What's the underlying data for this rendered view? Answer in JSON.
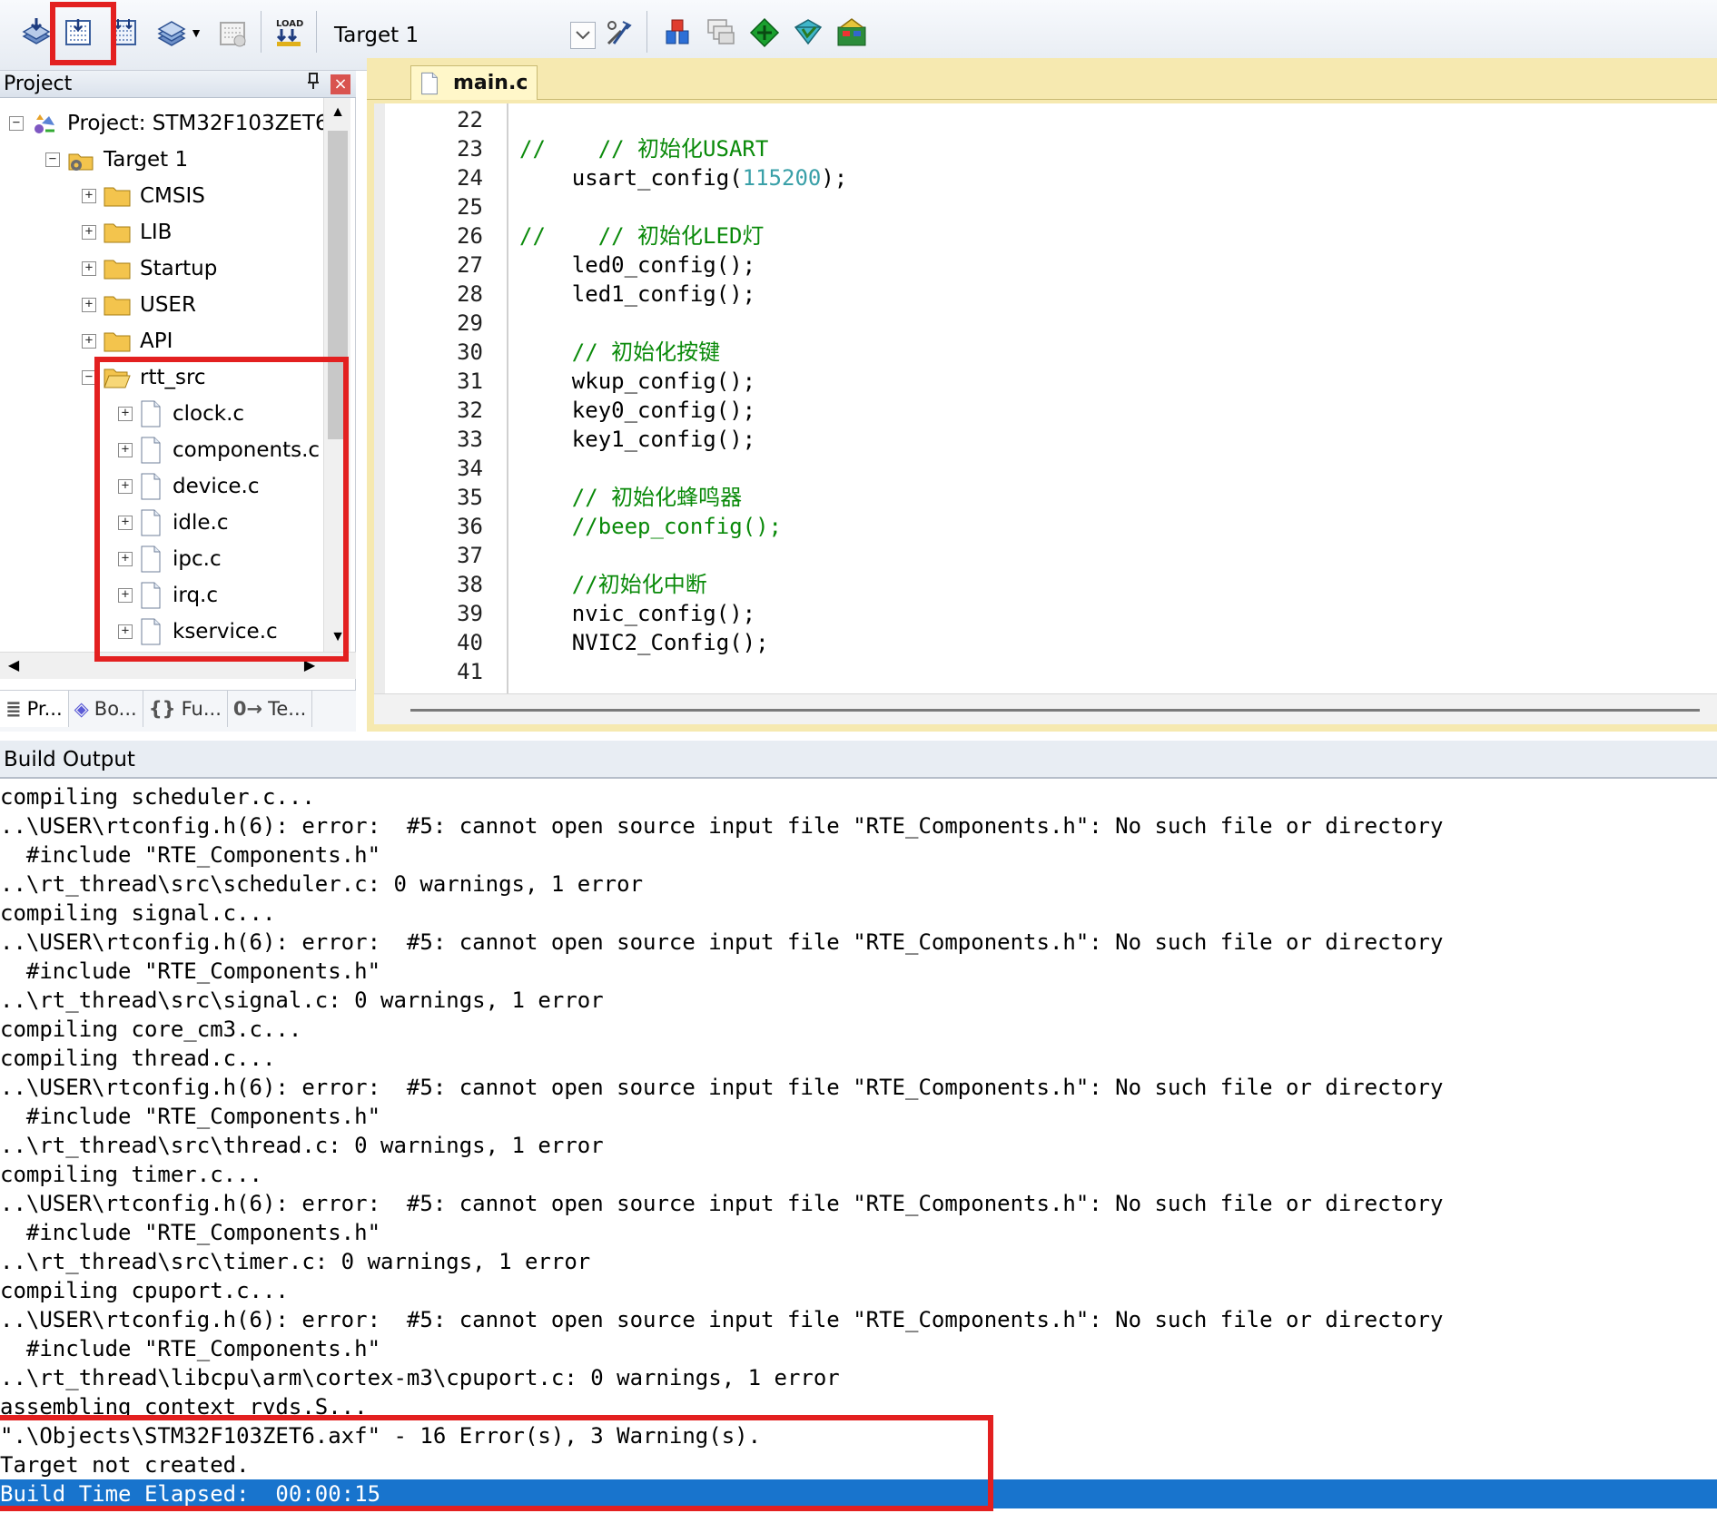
{
  "toolbar": {
    "buttons": [
      {
        "name": "translate-icon"
      },
      {
        "name": "build-icon"
      },
      {
        "name": "rebuild-icon"
      },
      {
        "name": "batch-build-icon"
      },
      {
        "name": "stop-build-icon"
      },
      {
        "name": "download-icon"
      }
    ],
    "target_select": "Target 1",
    "right_buttons": [
      {
        "name": "target-options-icon"
      },
      {
        "name": "manage-project-items-icon"
      },
      {
        "name": "select-packs-icon"
      },
      {
        "name": "manage-rte-icon"
      },
      {
        "name": "pack-installer-icon"
      },
      {
        "name": "view-rte-icon"
      }
    ],
    "highlight_color": "#e32020"
  },
  "project_pane": {
    "title": "Project",
    "pin": "ᵖ",
    "close": "×",
    "tree": [
      {
        "label": "Project: STM32F103ZET6",
        "sign": "⊟",
        "kind": "project"
      },
      {
        "label": "Target 1",
        "sign": "⊟",
        "kind": "target"
      },
      {
        "label": "CMSIS",
        "sign": "+",
        "kind": "folder"
      },
      {
        "label": "LIB",
        "sign": "+",
        "kind": "folder"
      },
      {
        "label": "Startup",
        "sign": "+",
        "kind": "folder"
      },
      {
        "label": "USER",
        "sign": "+",
        "kind": "folder"
      },
      {
        "label": "API",
        "sign": "+",
        "kind": "folder"
      },
      {
        "label": "rtt_src",
        "sign": "−",
        "kind": "folder-open"
      },
      {
        "label": "clock.c",
        "sign": "+",
        "kind": "file"
      },
      {
        "label": "components.c",
        "sign": "+",
        "kind": "file"
      },
      {
        "label": "device.c",
        "sign": "+",
        "kind": "file"
      },
      {
        "label": "idle.c",
        "sign": "+",
        "kind": "file"
      },
      {
        "label": "ipc.c",
        "sign": "+",
        "kind": "file"
      },
      {
        "label": "irq.c",
        "sign": "+",
        "kind": "file"
      },
      {
        "label": "kservice.c",
        "sign": "+",
        "kind": "file"
      }
    ],
    "tabs": [
      {
        "icon": "≣",
        "label": "Pr..."
      },
      {
        "icon": "◈",
        "label": "Bo..."
      },
      {
        "icon": "{}",
        "label": "Fu..."
      },
      {
        "icon": "0→",
        "label": "Te..."
      }
    ]
  },
  "editor": {
    "tab_label": "main.c",
    "lines": [
      {
        "n": "22",
        "segs": []
      },
      {
        "n": "23",
        "segs": [
          {
            "t": "//    // 初始化USART",
            "c": "cmt"
          }
        ]
      },
      {
        "n": "24",
        "segs": [
          {
            "t": "    usart_config(",
            "c": ""
          },
          {
            "t": "115200",
            "c": "num"
          },
          {
            "t": ");",
            "c": ""
          }
        ]
      },
      {
        "n": "25",
        "segs": []
      },
      {
        "n": "26",
        "segs": [
          {
            "t": "//    // 初始化LED灯",
            "c": "cmt"
          }
        ]
      },
      {
        "n": "27",
        "segs": [
          {
            "t": "    led0_config();",
            "c": ""
          }
        ]
      },
      {
        "n": "28",
        "segs": [
          {
            "t": "    led1_config();",
            "c": ""
          }
        ]
      },
      {
        "n": "29",
        "segs": []
      },
      {
        "n": "30",
        "segs": [
          {
            "t": "    // 初始化按键",
            "c": "cmt"
          }
        ]
      },
      {
        "n": "31",
        "segs": [
          {
            "t": "    wkup_config();",
            "c": ""
          }
        ]
      },
      {
        "n": "32",
        "segs": [
          {
            "t": "    key0_config();",
            "c": ""
          }
        ]
      },
      {
        "n": "33",
        "segs": [
          {
            "t": "    key1_config();",
            "c": ""
          }
        ]
      },
      {
        "n": "34",
        "segs": []
      },
      {
        "n": "35",
        "segs": [
          {
            "t": "    // 初始化蜂鸣器",
            "c": "cmt"
          }
        ]
      },
      {
        "n": "36",
        "segs": [
          {
            "t": "    //beep_config();",
            "c": "cmt"
          }
        ]
      },
      {
        "n": "37",
        "segs": []
      },
      {
        "n": "38",
        "segs": [
          {
            "t": "    //初始化中断",
            "c": "cmt"
          }
        ]
      },
      {
        "n": "39",
        "segs": [
          {
            "t": "    nvic_config();",
            "c": ""
          }
        ]
      },
      {
        "n": "40",
        "segs": [
          {
            "t": "    NVIC2_Config();",
            "c": ""
          }
        ]
      },
      {
        "n": "41",
        "segs": []
      }
    ]
  },
  "build_output": {
    "title": "Build Output",
    "lines": [
      "compiling scheduler.c...",
      "..\\USER\\rtconfig.h(6): error:  #5: cannot open source input file \"RTE_Components.h\": No such file or directory",
      "  #include \"RTE_Components.h\"",
      "..\\rt_thread\\src\\scheduler.c: 0 warnings, 1 error",
      "compiling signal.c...",
      "..\\USER\\rtconfig.h(6): error:  #5: cannot open source input file \"RTE_Components.h\": No such file or directory",
      "  #include \"RTE_Components.h\"",
      "..\\rt_thread\\src\\signal.c: 0 warnings, 1 error",
      "compiling core_cm3.c...",
      "compiling thread.c...",
      "..\\USER\\rtconfig.h(6): error:  #5: cannot open source input file \"RTE_Components.h\": No such file or directory",
      "  #include \"RTE_Components.h\"",
      "..\\rt_thread\\src\\thread.c: 0 warnings, 1 error",
      "compiling timer.c...",
      "..\\USER\\rtconfig.h(6): error:  #5: cannot open source input file \"RTE_Components.h\": No such file or directory",
      "  #include \"RTE_Components.h\"",
      "..\\rt_thread\\src\\timer.c: 0 warnings, 1 error",
      "compiling cpuport.c...",
      "..\\USER\\rtconfig.h(6): error:  #5: cannot open source input file \"RTE_Components.h\": No such file or directory",
      "  #include \"RTE_Components.h\"",
      "..\\rt_thread\\libcpu\\arm\\cortex-m3\\cpuport.c: 0 warnings, 1 error",
      "assembling context_rvds.S...",
      "\".\\Objects\\STM32F103ZET6.axf\" - 16 Error(s), 3 Warning(s).",
      "Target not created.",
      "Build Time Elapsed:  00:00:15"
    ]
  }
}
